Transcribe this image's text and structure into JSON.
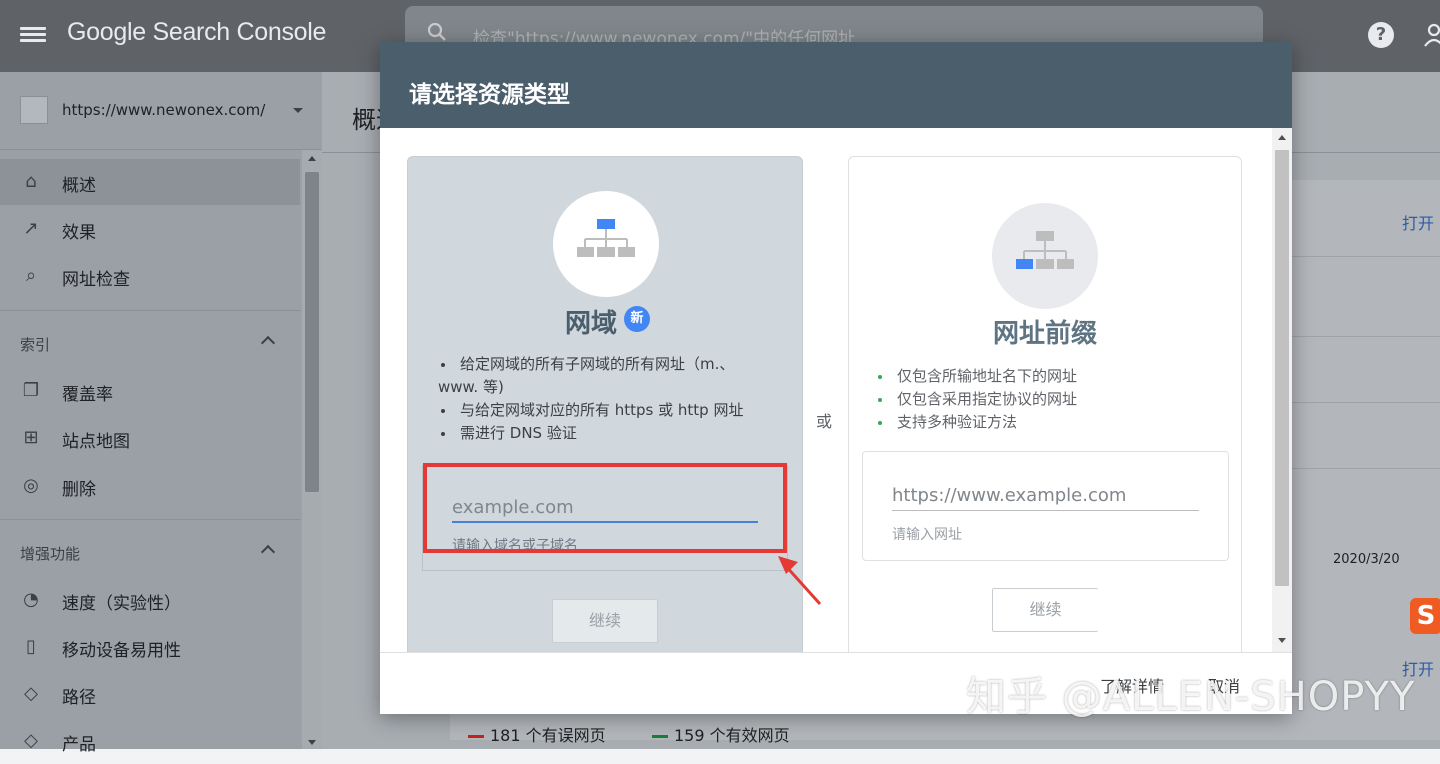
{
  "topbar": {
    "brand": "Google Search Console",
    "search_placeholder": "检查\"https://www.newonex.com/\"中的任何网址",
    "help": "?"
  },
  "sidebar": {
    "property_url": "https://www.newonex.com/",
    "items_top": [
      {
        "icon": "home-icon",
        "glyph": "⌂",
        "label": "概述"
      },
      {
        "icon": "trending-up-icon",
        "glyph": "↗",
        "label": "效果"
      },
      {
        "icon": "search-icon",
        "glyph": "⌕",
        "label": "网址检查"
      }
    ],
    "section_index": "索引",
    "items_index": [
      {
        "icon": "copy-icon",
        "glyph": "❐",
        "label": "覆盖率"
      },
      {
        "icon": "sitemap-icon",
        "glyph": "⊞",
        "label": "站点地图"
      },
      {
        "icon": "eye-off-icon",
        "glyph": "◎",
        "label": "删除"
      }
    ],
    "section_enhance": "增强功能",
    "items_enhance": [
      {
        "icon": "speed-icon",
        "glyph": "◔",
        "label": "速度（实验性）"
      },
      {
        "icon": "phone-icon",
        "glyph": "▯",
        "label": "移动设备易用性"
      },
      {
        "icon": "layers-icon",
        "glyph": "◇",
        "label": "路径"
      },
      {
        "icon": "layers-icon",
        "glyph": "◇",
        "label": "产品"
      }
    ]
  },
  "main": {
    "title": "概述",
    "open_link": "打开",
    "date": "2020/3/20",
    "legend_errors": "181 个有误网页",
    "legend_valid": "159 个有效网页",
    "color_errors": "#c5221f",
    "color_valid": "#188038"
  },
  "dialog": {
    "title": "请选择资源类型",
    "domain": {
      "name": "网域",
      "badge": "新",
      "bullet1": "给定网域的所有子网域的所有网址（m.、",
      "bullet1_cont": "www. 等)",
      "bullet2": "与给定网域对应的所有 https 或 http 网址",
      "bullet3": "需进行 DNS 验证",
      "input_placeholder": "example.com",
      "hint": "请输入域名或子域名",
      "continue": "继续"
    },
    "or": "或",
    "prefix": {
      "name": "网址前缀",
      "bullet1": "仅包含所输地址名下的网址",
      "bullet2": "仅包含采用指定协议的网址",
      "bullet3": "支持多种验证方法",
      "input_placeholder": "https://www.example.com",
      "hint": "请输入网址",
      "continue": "继续"
    },
    "learn_more": "了解详情",
    "cancel": "取消"
  },
  "watermark": "知乎 @ALLEN-SHOPYY",
  "accent": "#e53935"
}
